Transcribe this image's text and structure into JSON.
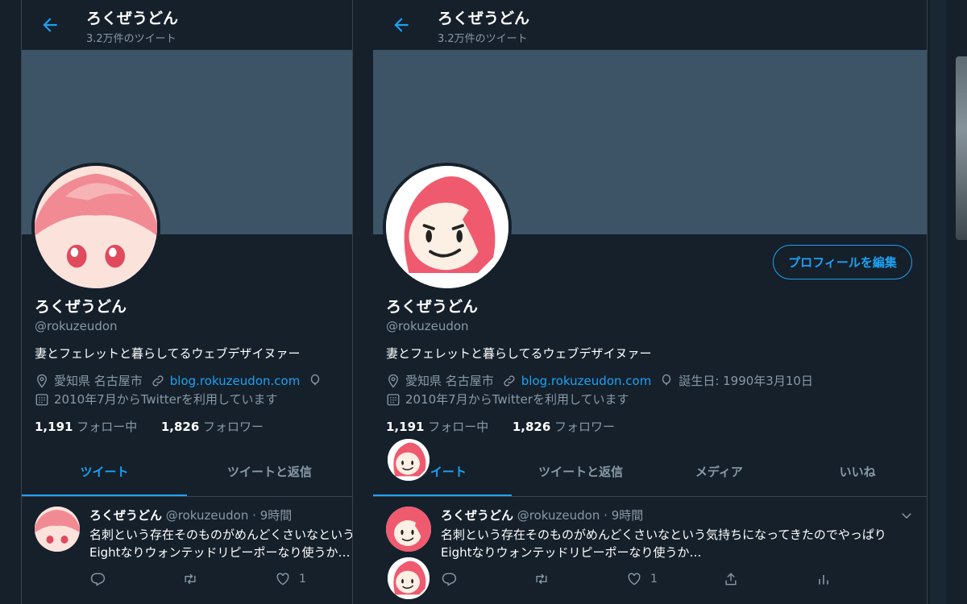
{
  "header": {
    "title": "ろくぜうどん",
    "tweet_count": "3.2万件のツイート"
  },
  "profile": {
    "name": "ろくぜうどん",
    "handle": "@rokuzeudon",
    "bio": "妻とフェレットと暮らしてるウェブデザイヌァー",
    "location": "愛知県 名古屋市",
    "website": "blog.rokuzeudon.com",
    "birthday": "誕生日: 1990年3月10日",
    "joined": "2010年7月からTwitterを利用しています",
    "following_count": "1,191",
    "following_label": "フォロー中",
    "followers_count": "1,826",
    "followers_label": "フォロワー",
    "edit_button": "プロフィールを編集"
  },
  "tabs": [
    "ツイート",
    "ツイートと返信",
    "メディア",
    "いいね"
  ],
  "tweet": {
    "name": "ろくぜうどん",
    "handle": "@rokuzeudon",
    "sep": "·",
    "time": "9時間",
    "text_narrow": "名刺という存在そのものがめんどくさいなという\nEightなりウォンテッドリピーポーなり使うか…",
    "text_wide": "名刺という存在そのものがめんどくさいなという気持ちになってきたのでやっぱり\nEightなりウォンテッドリピーポーなり使うか…",
    "likes": "1"
  },
  "colors": {
    "background": "#15202b",
    "banner": "#3d5466",
    "accent": "#1da1f2",
    "muted": "#8899a6",
    "border": "#38444d"
  },
  "icons": [
    "back-arrow-icon",
    "location-icon",
    "link-icon",
    "balloon-icon",
    "calendar-icon",
    "reply-icon",
    "retweet-icon",
    "like-icon",
    "share-icon",
    "analytics-icon",
    "chevron-down-icon"
  ]
}
